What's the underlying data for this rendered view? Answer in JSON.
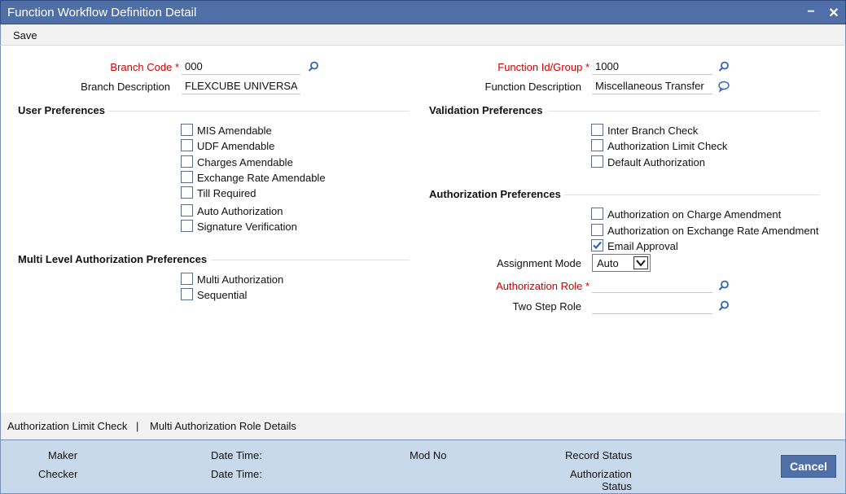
{
  "window": {
    "title": "Function Workflow Definition Detail",
    "minimize": "−",
    "close": "✕"
  },
  "menu": {
    "save": "Save"
  },
  "fields": {
    "branch_code": {
      "label": "Branch Code",
      "required": "*",
      "value": "000"
    },
    "branch_description": {
      "label": "Branch Description",
      "value": "FLEXCUBE UNIVERSAL"
    },
    "function_id": {
      "label": "Function Id/Group",
      "required": "*",
      "value": "1000"
    },
    "function_description": {
      "label": "Function Description",
      "value": "Miscellaneous Transfer"
    }
  },
  "user_preferences": {
    "heading": "User Preferences",
    "items": [
      {
        "label": "MIS Amendable",
        "checked": false
      },
      {
        "label": "UDF Amendable",
        "checked": false
      },
      {
        "label": "Charges Amendable",
        "checked": false
      },
      {
        "label": "Exchange Rate Amendable",
        "checked": false
      },
      {
        "label": "Till Required",
        "checked": false
      },
      {
        "label": "Auto Authorization",
        "checked": false
      },
      {
        "label": "Signature Verification",
        "checked": false
      }
    ]
  },
  "validation_preferences": {
    "heading": "Validation Preferences",
    "items": [
      {
        "label": "Inter Branch Check",
        "checked": false
      },
      {
        "label": "Authorization Limit Check",
        "checked": false
      },
      {
        "label": "Default Authorization",
        "checked": false
      }
    ]
  },
  "authorization_preferences": {
    "heading": "Authorization Preferences",
    "items": [
      {
        "label": "Authorization on Charge Amendment",
        "checked": false
      },
      {
        "label": "Authorization on Exchange Rate Amendment",
        "checked": false
      },
      {
        "label": "Email Approval",
        "checked": true
      }
    ],
    "assignment_mode": {
      "label": "Assignment Mode",
      "value": "Auto"
    },
    "authorization_role": {
      "label": "Authorization Role",
      "required": "*",
      "value": ""
    },
    "two_step_role": {
      "label": "Two Step Role",
      "value": ""
    }
  },
  "multi_level": {
    "heading": "Multi Level Authorization Preferences",
    "items": [
      {
        "label": "Multi Authorization",
        "checked": false
      },
      {
        "label": "Sequential",
        "checked": false
      }
    ]
  },
  "subbar": {
    "auth_limit_check": "Authorization Limit Check",
    "separator": "|",
    "multi_auth_role": "Multi Authorization Role Details"
  },
  "footer": {
    "maker": "Maker",
    "checker": "Checker",
    "date_time_1": "Date Time:",
    "date_time_2": "Date Time:",
    "mod_no": "Mod No",
    "record_status": "Record Status",
    "authorization_status_line1": "Authorization",
    "authorization_status_line2": "Status",
    "cancel": "Cancel"
  },
  "colors": {
    "titlebar": "#4f6fa6",
    "footer": "#c9d9ec",
    "required": "#cc0000",
    "icon": "#2f64b5"
  }
}
